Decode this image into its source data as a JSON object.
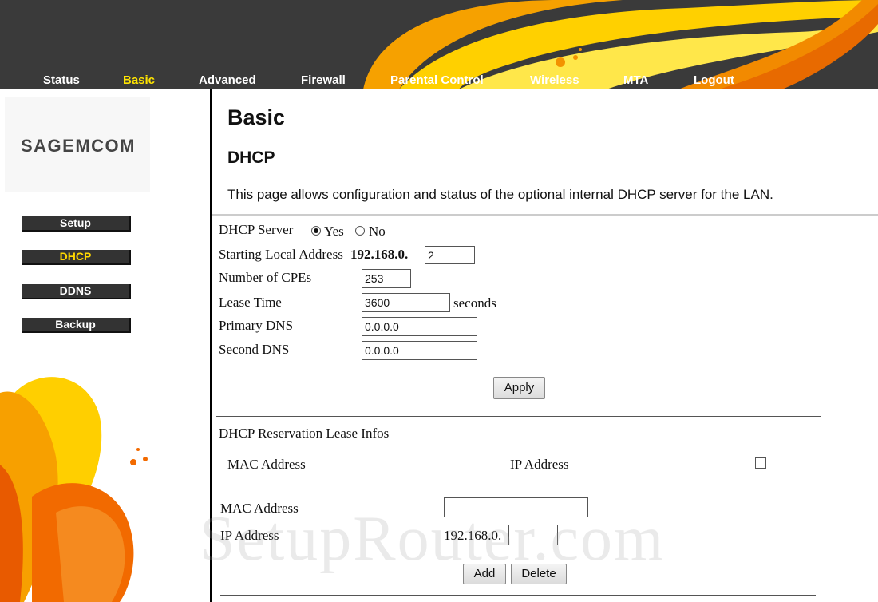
{
  "nav": {
    "items": [
      {
        "label": "Status"
      },
      {
        "label": "Basic",
        "active": true
      },
      {
        "label": "Advanced"
      },
      {
        "label": "Firewall"
      },
      {
        "label": "Parental Control"
      },
      {
        "label": "Wireless"
      },
      {
        "label": "MTA"
      },
      {
        "label": "Logout"
      }
    ]
  },
  "brand": {
    "logo": "Sagemcom"
  },
  "sidebar": {
    "items": [
      {
        "label": "Setup"
      },
      {
        "label": "DHCP",
        "active": true
      },
      {
        "label": "DDNS"
      },
      {
        "label": "Backup"
      }
    ]
  },
  "page": {
    "title": "Basic",
    "section": "DHCP",
    "description": "This page allows configuration and status of the optional internal DHCP server for the LAN."
  },
  "dhcp_form": {
    "server_label": "DHCP Server",
    "yes_label": "Yes",
    "no_label": "No",
    "start_label": "Starting Local Address",
    "start_prefix": "192.168.0.",
    "start_value": "2",
    "cpes_label": "Number of CPEs",
    "cpes_value": "253",
    "lease_label": "Lease Time",
    "lease_value": "3600",
    "lease_unit": "seconds",
    "dns1_label": "Primary DNS",
    "dns1_value": "0.0.0.0",
    "dns2_label": "Second DNS",
    "dns2_value": "0.0.0.0",
    "apply_label": "Apply"
  },
  "reservation": {
    "title": "DHCP Reservation Lease Infos",
    "col_mac": "MAC Address",
    "col_ip": "IP Address",
    "mac_label": "MAC Address",
    "mac_value": "",
    "ip_label": "IP Address",
    "ip_prefix": "192.168.0.",
    "ip_value": "",
    "add_label": "Add",
    "delete_label": "Delete"
  },
  "watermark": "SetupRouter.com",
  "colors": {
    "header_bg": "#3a3a3a",
    "nav_active": "#ffe400",
    "accent_orange": "#f39200",
    "accent_yellow": "#ffd200"
  }
}
